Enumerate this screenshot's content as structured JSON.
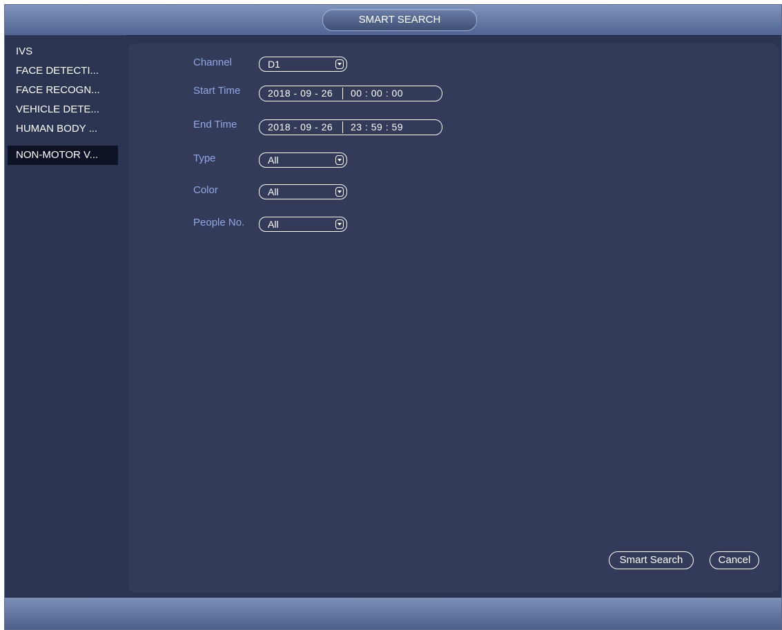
{
  "window": {
    "title": "SMART SEARCH"
  },
  "sidebar": {
    "items": [
      {
        "label": "IVS",
        "active": false
      },
      {
        "label": "FACE DETECTI...",
        "active": false
      },
      {
        "label": "FACE RECOGN...",
        "active": false
      },
      {
        "label": "VEHICLE DETE...",
        "active": false
      },
      {
        "label": "HUMAN BODY ...",
        "active": false
      },
      {
        "label": "NON-MOTOR V...",
        "active": true
      }
    ]
  },
  "form": {
    "channel": {
      "label": "Channel",
      "value": "D1"
    },
    "start_time": {
      "label": "Start Time",
      "date": "2018 - 09 - 26",
      "time": "00 : 00 : 00"
    },
    "end_time": {
      "label": "End Time",
      "date": "2018 - 09 - 26",
      "time": "23 : 59 : 59"
    },
    "type": {
      "label": "Type",
      "value": "All"
    },
    "color": {
      "label": "Color",
      "value": "All"
    },
    "people_no": {
      "label": "People No.",
      "value": "All"
    }
  },
  "buttons": {
    "smart_search": "Smart Search",
    "cancel": "Cancel"
  },
  "colors": {
    "background": "#2b3450",
    "panel": "#333b58",
    "label": "#8fa8e6",
    "active_item": "#0d1224"
  },
  "icons": {
    "dropdown_arrow": "chevron-down-icon"
  }
}
